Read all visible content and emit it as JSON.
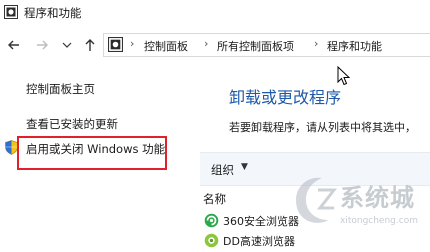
{
  "window": {
    "title": "程序和功能",
    "icon": "control-panel-icon"
  },
  "nav": {
    "back_icon": "back-arrow-icon",
    "forward_icon": "forward-arrow-icon",
    "recent_icon": "chevron-down-icon",
    "up_icon": "up-arrow-icon",
    "address_icon": "control-panel-icon",
    "breadcrumbs": [
      "控制面板",
      "所有控制面板项",
      "程序和功能"
    ],
    "separator": "›"
  },
  "sidebar": {
    "items": [
      {
        "label": "控制面板主页"
      },
      {
        "label": "查看已安装的更新"
      },
      {
        "label": "启用或关闭 Windows 功能",
        "icon": "uac-shield-icon",
        "highlighted": true
      }
    ],
    "highlight_color": "#e0202a"
  },
  "main": {
    "heading": "卸载或更改程序",
    "description": "若要卸载程序，请从列表中将其选中，",
    "toolbar": {
      "organize_label": "组织",
      "caret": "▼"
    },
    "column_header": "名称",
    "programs": [
      {
        "name": "360安全浏览器",
        "icon": "360-browser-icon"
      },
      {
        "name": "DD高速浏览器",
        "icon": "dd-browser-icon"
      }
    ],
    "heading_color": "#1e5aa8"
  },
  "watermark": {
    "text": "系统城",
    "sub": "xitongcheng.com"
  }
}
